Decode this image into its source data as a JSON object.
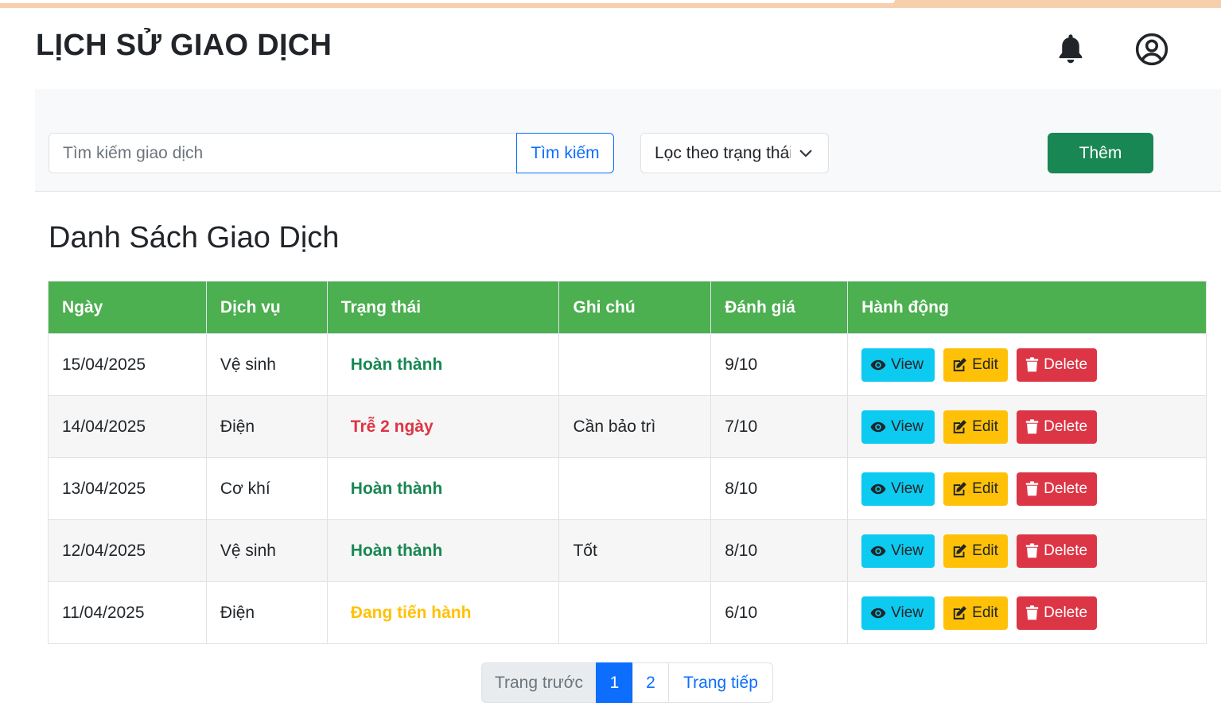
{
  "header": {
    "title": "LỊCH SỬ GIAO DỊCH",
    "icons": [
      "bell-icon",
      "user-circle-icon"
    ]
  },
  "toolbar": {
    "search_placeholder": "Tìm kiếm giao dịch",
    "search_button": "Tìm kiếm",
    "filter_label": "Lọc theo trạng thái",
    "add_button": "Thêm"
  },
  "section_title": "Danh Sách Giao Dịch",
  "table": {
    "headers": [
      "Ngày",
      "Dịch vụ",
      "Trạng thái",
      "Ghi chú",
      "Đánh giá",
      "Hành động"
    ],
    "rows": [
      {
        "date": "15/04/2025",
        "service": "Vệ sinh",
        "status": "Hoàn thành",
        "note": "",
        "rating": "9/10"
      },
      {
        "date": "14/04/2025",
        "service": "Điện",
        "status": "Trễ 2 ngày",
        "note": "Cần bảo trì",
        "rating": "7/10"
      },
      {
        "date": "13/04/2025",
        "service": "Cơ khí",
        "status": "Hoàn thành",
        "note": "",
        "rating": "8/10"
      },
      {
        "date": "12/04/2025",
        "service": "Vệ sinh",
        "status": "Hoàn thành",
        "note": "Tốt",
        "rating": "8/10"
      },
      {
        "date": "11/04/2025",
        "service": "Điện",
        "status": "Đang tiến hành",
        "note": "",
        "rating": "6/10"
      }
    ],
    "actions": {
      "view": "View",
      "edit": "Edit",
      "delete": "Delete"
    }
  },
  "status_colors": {
    "Hoàn thành": "#198754",
    "Trễ 2 ngày": "#dc3545",
    "Đang tiến hành": "#ffc107"
  },
  "pagination": {
    "prev": "Trang trước",
    "pages": [
      "1",
      "2"
    ],
    "current": "1",
    "next": "Trang tiếp"
  }
}
